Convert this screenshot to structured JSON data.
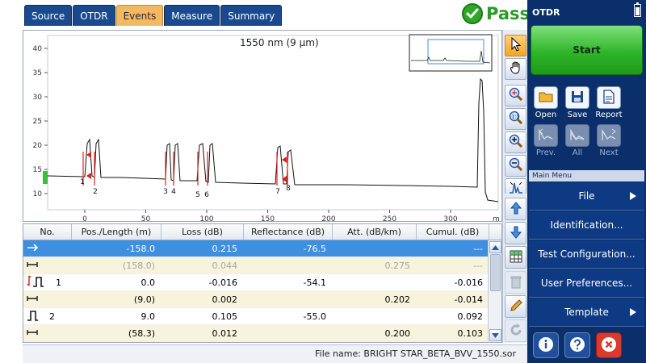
{
  "tabs": [
    {
      "label": "Source",
      "active": false
    },
    {
      "label": "OTDR",
      "active": false
    },
    {
      "label": "Events",
      "active": true
    },
    {
      "label": "Measure",
      "active": false
    },
    {
      "label": "Summary",
      "active": false
    }
  ],
  "status": {
    "label": "Pass",
    "color": "#2b9a26"
  },
  "graph": {
    "title": "1550 nm (9 μm)",
    "x_unit": "m",
    "y_ticks": [
      "40",
      "35",
      "30",
      "25",
      "20",
      "15",
      "10"
    ],
    "x_ticks": [
      "0",
      "50",
      "100",
      "150",
      "200",
      "250",
      "300"
    ],
    "event_markers": [
      "1",
      "2",
      "3",
      "4",
      "5",
      "6",
      "7",
      "8"
    ]
  },
  "table": {
    "headers": [
      "No.",
      "Pos./Length (m)",
      "Loss (dB)",
      "Reflectance (dB)",
      "Att. (dB/km)",
      "Cumul. (dB)"
    ],
    "rows": [
      {
        "kind": "sel",
        "icon": "arrow-right-icon",
        "no": "",
        "pos": "-158.0",
        "loss": "0.215",
        "refl": "-76.5",
        "att": "",
        "cumul": "---",
        "muted": false
      },
      {
        "kind": "span",
        "icon": "span-icon",
        "no": "",
        "pos": "(158.0)",
        "loss": "0.044",
        "refl": "",
        "att": "0.275",
        "cumul": "---",
        "muted": true
      },
      {
        "kind": "event",
        "icon": "launch-reflective-icon",
        "no": "1",
        "pos": "0.0",
        "loss": "-0.016",
        "refl": "-54.1",
        "att": "",
        "cumul": "-0.016",
        "muted": false
      },
      {
        "kind": "span",
        "icon": "span-icon",
        "no": "",
        "pos": "(9.0)",
        "loss": "0.002",
        "refl": "",
        "att": "0.202",
        "cumul": "-0.014",
        "muted": false
      },
      {
        "kind": "event",
        "icon": "reflective-event-icon",
        "no": "2",
        "pos": "9.0",
        "loss": "0.105",
        "refl": "-55.0",
        "att": "",
        "cumul": "0.092",
        "muted": false
      },
      {
        "kind": "span",
        "icon": "span-icon",
        "no": "",
        "pos": "(58.3)",
        "loss": "0.012",
        "refl": "",
        "att": "0.200",
        "cumul": "0.103",
        "muted": false
      }
    ]
  },
  "file": {
    "label": "File name: BRIGHT STAR_BETA_BVV_1550.sor"
  },
  "panel": {
    "title": "OTDR",
    "start": "Start",
    "open": "Open",
    "save": "Save",
    "report": "Report",
    "prev": "Prev.",
    "all": "All",
    "next": "Next",
    "menu_title": "Main Menu",
    "menu": [
      "File",
      "Identification...",
      "Test Configuration...",
      "User Preferences...",
      "Template"
    ]
  },
  "colors": {
    "panel_bg": "#0a2f6b",
    "tab_active": "#f4b860",
    "tab_inactive": "#1a4a8d",
    "selected_row": "#3e8fe0",
    "trace": "#000000",
    "marker": "#e02020",
    "start_green": "#2fb52a"
  }
}
